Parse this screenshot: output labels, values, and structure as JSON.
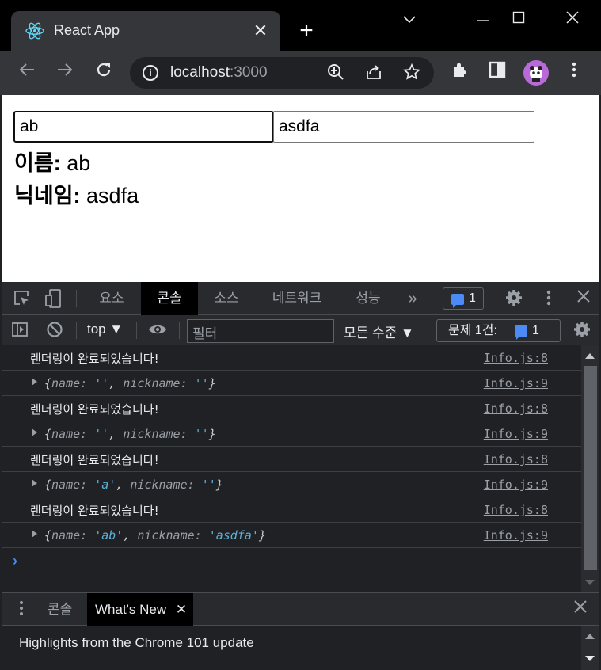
{
  "browser": {
    "tab_title": "React App",
    "tab_close": "✕",
    "new_tab": "+",
    "url_host": "localhost",
    "url_port": ":3000"
  },
  "page": {
    "name_value": "ab",
    "nickname_value": "asdfa",
    "name_label": "이름:",
    "name_text": "ab",
    "nickname_label": "닉네임:",
    "nickname_text": "asdfa"
  },
  "devtools": {
    "tabs": [
      "요소",
      "콘솔",
      "소스",
      "네트워크",
      "성능"
    ],
    "more": "»",
    "issue_count": "1",
    "context": "top ▼",
    "filter_placeholder": "필터",
    "levels": "모든 수준 ▼",
    "issues_label": "문제 1건:",
    "issues_count": "1",
    "console_rows": [
      {
        "type": "text",
        "text": "렌더링이 완료되었습니다!",
        "src": "Info.js:8"
      },
      {
        "type": "obj",
        "name": "''",
        "nickname": "''",
        "src": "Info.js:9"
      },
      {
        "type": "text",
        "text": "렌더링이 완료되었습니다!",
        "src": "Info.js:8"
      },
      {
        "type": "obj",
        "name": "''",
        "nickname": "''",
        "src": "Info.js:9"
      },
      {
        "type": "text",
        "text": "렌더링이 완료되었습니다!",
        "src": "Info.js:8"
      },
      {
        "type": "obj",
        "name": "'a'",
        "nickname": "''",
        "src": "Info.js:9"
      },
      {
        "type": "text",
        "text": "렌더링이 완료되었습니다!",
        "src": "Info.js:8"
      },
      {
        "type": "obj",
        "name": "'ab'",
        "nickname": "'asdfa'",
        "src": "Info.js:9"
      }
    ],
    "prompt": "›",
    "drawer_tabs": [
      "콘솔",
      "What's New"
    ],
    "drawer_close": "✕",
    "drawer_text": "Highlights from the Chrome 101 update"
  },
  "colors": {
    "accent": "#4c8bf5",
    "string": "#5db0d7",
    "avatar": "#b96ad9"
  }
}
